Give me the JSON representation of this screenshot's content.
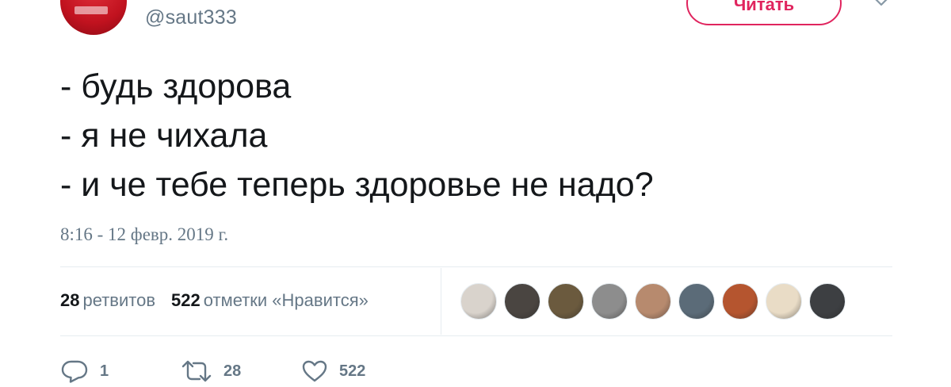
{
  "author": {
    "handle": "@saut333",
    "avatar_color": "#c1121f"
  },
  "header": {
    "follow_label": "Читать",
    "accent_color": "#e0245e"
  },
  "tweet": {
    "lines": [
      "- будь здорова",
      "- я не чихала",
      "- и че тебе теперь здоровье не надо?"
    ],
    "timestamp": "8:16 - 12 февр. 2019 г."
  },
  "stats": {
    "retweets_count": "28",
    "retweets_label": "ретвитов",
    "likes_count": "522",
    "likes_label": "отметки «Нравится»"
  },
  "likers": [
    {
      "icon": "liker-avatar-dog",
      "color": "#d9d3cc"
    },
    {
      "icon": "liker-avatar-face",
      "color": "#4a4541"
    },
    {
      "icon": "liker-avatar-man",
      "color": "#6b5a3e"
    },
    {
      "icon": "liker-avatar-bw",
      "color": "#8d8d8d"
    },
    {
      "icon": "liker-avatar-sunglasses",
      "color": "#b78a6e"
    },
    {
      "icon": "liker-avatar-landscape",
      "color": "#5b6b78"
    },
    {
      "icon": "liker-avatar-colorful",
      "color": "#b5552f"
    },
    {
      "icon": "liker-avatar-earrings",
      "color": "#e9dcc6"
    },
    {
      "icon": "liker-avatar-bearded",
      "color": "#3d3f42"
    }
  ],
  "actions": {
    "reply_count": "1",
    "retweet_count": "28",
    "like_count": "522",
    "icons": [
      "reply-icon",
      "retweet-icon",
      "heart-icon"
    ]
  }
}
